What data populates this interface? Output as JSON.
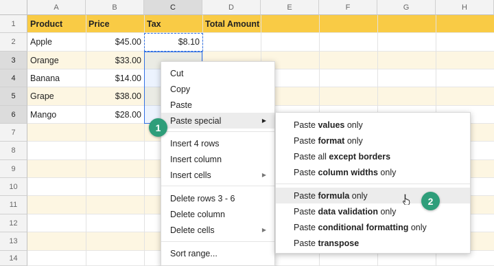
{
  "columns": [
    "A",
    "B",
    "C",
    "D",
    "E",
    "F",
    "G",
    "H"
  ],
  "rows": [
    "1",
    "2",
    "3",
    "4",
    "5",
    "6",
    "7",
    "8",
    "9",
    "10",
    "11",
    "12",
    "13",
    "14"
  ],
  "header_cells": {
    "a": "Product",
    "b": "Price",
    "c": "Tax",
    "d": "Total Amount"
  },
  "data_rows": [
    {
      "product": "Apple",
      "price": "$45.00",
      "tax": "$8.10"
    },
    {
      "product": "Orange",
      "price": "$33.00",
      "tax": ""
    },
    {
      "product": "Banana",
      "price": "$14.00",
      "tax": ""
    },
    {
      "product": "Grape",
      "price": "$38.00",
      "tax": ""
    },
    {
      "product": "Mango",
      "price": "$28.00",
      "tax": ""
    }
  ],
  "context_menu": {
    "cut": "Cut",
    "copy": "Copy",
    "paste": "Paste",
    "paste_special": "Paste special",
    "insert_rows": "Insert 4 rows",
    "insert_column": "Insert column",
    "insert_cells": "Insert cells",
    "delete_rows": "Delete rows 3 - 6",
    "delete_column": "Delete column",
    "delete_cells": "Delete cells",
    "sort_range": "Sort range..."
  },
  "paste_special_menu": [
    {
      "pre": "Paste ",
      "bold": "values",
      "post": " only"
    },
    {
      "pre": "Paste ",
      "bold": "format",
      "post": " only"
    },
    {
      "pre": "Paste all ",
      "bold": "except borders",
      "post": ""
    },
    {
      "pre": "Paste ",
      "bold": "column widths",
      "post": " only"
    },
    {
      "pre": "Paste ",
      "bold": "formula",
      "post": " only"
    },
    {
      "pre": "Paste ",
      "bold": "data validation",
      "post": " only"
    },
    {
      "pre": "Paste ",
      "bold": "conditional formatting",
      "post": " only"
    },
    {
      "pre": "Paste ",
      "bold": "transpose",
      "post": ""
    }
  ],
  "badges": {
    "one": "1",
    "two": "2"
  },
  "colors": {
    "header_fill": "#f9cb45",
    "band_fill": "#fdf6e2",
    "selection": "#2f6fe4",
    "badge": "#2e9e7a"
  },
  "icons": {
    "submenu": "triangle-right-icon",
    "cursor": "hand-pointer-icon"
  }
}
